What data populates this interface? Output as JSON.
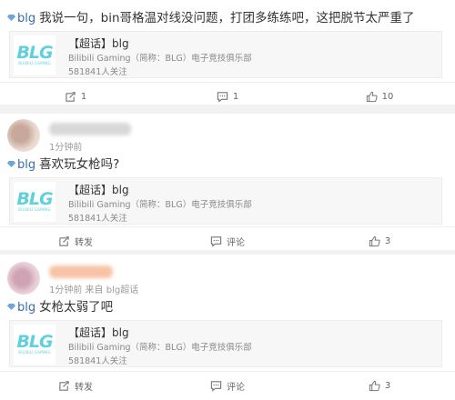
{
  "colors": {
    "topic": "#3b6ea8",
    "logo": "#5fd0dc",
    "muted": "#999999"
  },
  "posts": [
    {
      "topic": "blg",
      "text": "我说一句，bin哥格温对线没问题，打团多练练吧，这把脱节太严重了",
      "card": {
        "title": "【超话】blg",
        "desc": "Bilibili Gaming（简称：BLG）电子竞技俱乐部",
        "followers": "581841人关注",
        "logo_text": "BLG",
        "logo_sub": "BILIBILI GAMING"
      },
      "actions": {
        "repost": "1",
        "comment": "1",
        "like": "10"
      }
    },
    {
      "meta": "1分钟前",
      "topic": "blg",
      "text": "喜欢玩女枪吗?",
      "card": {
        "title": "【超话】blg",
        "desc": "Bilibili Gaming（简称：BLG）电子竞技俱乐部",
        "followers": "581841人关注",
        "logo_text": "BLG",
        "logo_sub": "BILIBILI GAMING"
      },
      "actions": {
        "repost": "转发",
        "comment": "评论",
        "like": "3"
      }
    },
    {
      "meta": "1分钟前 来自 blg超话",
      "topic": "blg",
      "text": "女枪太弱了吧",
      "card": {
        "title": "【超话】blg",
        "desc": "Bilibili Gaming（简称：BLG）电子竞技俱乐部",
        "followers": "581841人关注",
        "logo_text": "BLG",
        "logo_sub": "BILIBILI GAMING"
      },
      "actions": {
        "repost": "转发",
        "comment": "评论",
        "like": "3"
      }
    }
  ]
}
